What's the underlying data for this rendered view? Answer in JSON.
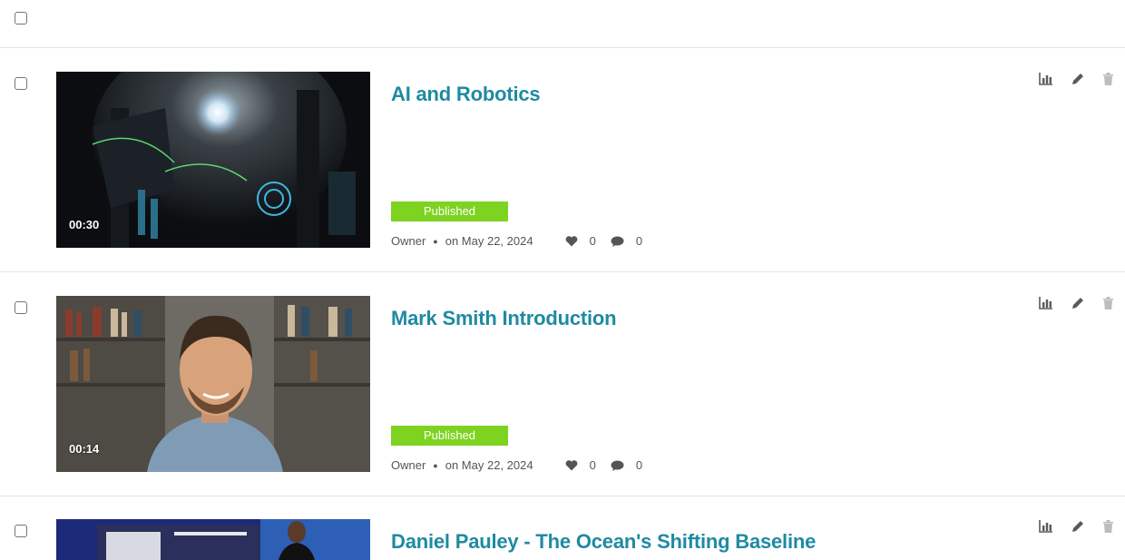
{
  "select_all": {
    "checked": false
  },
  "entries": [
    {
      "title": "AI and Robotics",
      "duration": "00:30",
      "status": "Published",
      "owner": "Owner",
      "date": "on May 22, 2024",
      "likes": "0",
      "comments": "0",
      "thumbnail": "robotics-render"
    },
    {
      "title": "Mark Smith Introduction",
      "duration": "00:14",
      "status": "Published",
      "owner": "Owner",
      "date": "on May 22, 2024",
      "likes": "0",
      "comments": "0",
      "thumbnail": "man-in-front-of-bookshelf"
    },
    {
      "title": "Daniel Pauley - The Ocean's Shifting Baseline",
      "thumbnail": "presentation-stage"
    }
  ],
  "icons": {
    "stats": "bar-chart-icon",
    "edit": "pencil-icon",
    "delete": "trash-icon",
    "likes": "heart-icon",
    "comments": "comment-icon"
  },
  "colors": {
    "title": "#1f8aa2",
    "published_badge": "#7ed321",
    "icon": "#5a5a5a",
    "disabled_icon": "#bdbdbd"
  }
}
